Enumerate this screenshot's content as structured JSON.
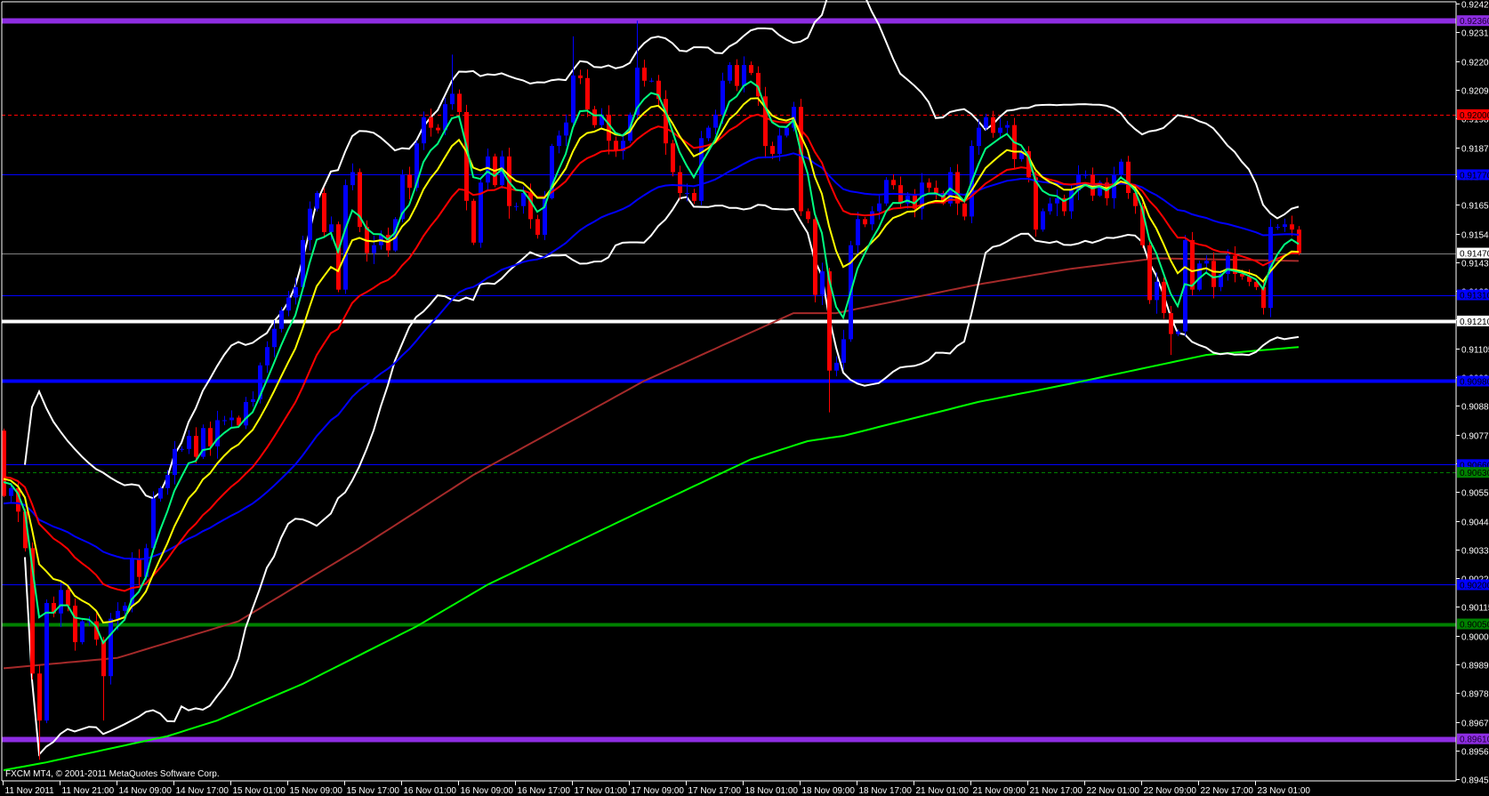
{
  "window": {
    "copyright": "FXCM MT4, © 2001-2011 MetaQuotes Software Corp."
  },
  "chart_data": {
    "type": "candlestick",
    "title": "",
    "ylim": [
      0.89449,
      0.92439
    ],
    "grid": false,
    "candle_colors": {
      "bull": "#0000ff",
      "bear": "#ff0000"
    },
    "y_ticks": [
      "0.92425",
      "0.92315",
      "0.92205",
      "0.92095",
      "0.91985",
      "0.91875",
      "0.91765",
      "0.91655",
      "0.91545",
      "0.91435",
      "0.91325",
      "0.91215",
      "0.91105",
      "0.90995",
      "0.90885",
      "0.90775",
      "0.90665",
      "0.90555",
      "0.90445",
      "0.90335",
      "0.90225",
      "0.90115",
      "0.90005",
      "0.89895",
      "0.89785",
      "0.89675",
      "0.89565",
      "0.89455"
    ],
    "x_tick_every_candles": 8,
    "x_tick_labels": [
      "11 Nov 2011",
      "11 Nov 21:00",
      "14 Nov 09:00",
      "14 Nov 17:00",
      "15 Nov 01:00",
      "15 Nov 09:00",
      "15 Nov 17:00",
      "16 Nov 01:00",
      "16 Nov 09:00",
      "16 Nov 17:00",
      "17 Nov 01:00",
      "17 Nov 09:00",
      "17 Nov 17:00",
      "18 Nov 01:00",
      "18 Nov 09:00",
      "18 Nov 17:00",
      "21 Nov 01:00",
      "21 Nov 09:00",
      "21 Nov 17:00",
      "22 Nov 01:00",
      "22 Nov 09:00",
      "22 Nov 17:00",
      "23 Nov 01:00"
    ],
    "first_open": 0.9079,
    "closes": [
      0.9054,
      0.9057,
      0.9048,
      0.9034,
      0.8986,
      0.8968,
      0.9013,
      0.9009,
      0.9018,
      0.9012,
      0.8998,
      0.9006,
      0.9006,
      0.8999,
      0.8985,
      0.9007,
      0.901,
      0.9012,
      0.903,
      0.9023,
      0.9034,
      0.9053,
      0.9057,
      0.9062,
      0.9072,
      0.9072,
      0.9077,
      0.9069,
      0.908,
      0.9073,
      0.9083,
      0.9083,
      0.9084,
      0.9081,
      0.909,
      0.9091,
      0.9104,
      0.9111,
      0.9118,
      0.9125,
      0.913,
      0.9134,
      0.9152,
      0.9164,
      0.917,
      0.9155,
      0.9158,
      0.9133,
      0.9173,
      0.9178,
      0.9157,
      0.9147,
      0.915,
      0.9154,
      0.9148,
      0.916,
      0.9177,
      0.9172,
      0.9189,
      0.9199,
      0.9195,
      0.9194,
      0.9204,
      0.9208,
      0.9201,
      0.9167,
      0.9151,
      0.9174,
      0.9184,
      0.9173,
      0.9184,
      0.9165,
      0.9165,
      0.917,
      0.916,
      0.9154,
      0.9168,
      0.9188,
      0.9192,
      0.9197,
      0.9215,
      0.9214,
      0.9202,
      0.9196,
      0.92,
      0.919,
      0.9186,
      0.919,
      0.92,
      0.9218,
      0.9213,
      0.9213,
      0.9206,
      0.9189,
      0.9178,
      0.917,
      0.917,
      0.9167,
      0.9191,
      0.9195,
      0.92,
      0.9213,
      0.9219,
      0.9211,
      0.9219,
      0.9216,
      0.9207,
      0.9188,
      0.9185,
      0.9192,
      0.9195,
      0.9203,
      0.9163,
      0.916,
      0.9131,
      0.914,
      0.9102,
      0.9105,
      0.9114,
      0.915,
      0.916,
      0.9158,
      0.9163,
      0.9166,
      0.9175,
      0.9173,
      0.9166,
      0.9169,
      0.9164,
      0.9174,
      0.9172,
      0.917,
      0.9166,
      0.9178,
      0.9166,
      0.9161,
      0.9188,
      0.9195,
      0.9199,
      0.9193,
      0.9195,
      0.9196,
      0.9183,
      0.9186,
      0.9176,
      0.9156,
      0.9163,
      0.9166,
      0.9168,
      0.9163,
      0.9171,
      0.9177,
      0.9177,
      0.9169,
      0.9174,
      0.9168,
      0.9177,
      0.9182,
      0.917,
      0.9165,
      0.915,
      0.9129,
      0.9136,
      0.9124,
      0.9116,
      0.9117,
      0.9152,
      0.9133,
      0.9143,
      0.9144,
      0.9134,
      0.9139,
      0.9146,
      0.9139,
      0.9138,
      0.9136,
      0.9134,
      0.9126,
      0.9157,
      0.9157,
      0.9158,
      0.9156,
      0.9147
    ],
    "extremes": [
      {
        "i": 5,
        "low": 0.8953
      },
      {
        "i": 14,
        "low": 0.8968
      },
      {
        "i": 63,
        "high": 0.9223
      },
      {
        "i": 80,
        "high": 0.923
      },
      {
        "i": 89,
        "high": 0.9236
      },
      {
        "i": 116,
        "low": 0.9086
      },
      {
        "i": 164,
        "low": 0.9108
      }
    ],
    "levels": [
      {
        "price": 0.9236,
        "label": "0.92360",
        "color": "#8e2de2",
        "label_text": "#1a0033",
        "style": "solid",
        "weight": "thick"
      },
      {
        "price": 0.92,
        "label": "0.92000",
        "color": "#ff0000",
        "label_text": "#000000",
        "style": "dashed",
        "weight": "thin"
      },
      {
        "price": 0.9177,
        "label": "0.91770",
        "color": "#0000ff",
        "label_text": "#000000",
        "style": "solid",
        "weight": "thin"
      },
      {
        "price": 0.9147,
        "label": "0.91470",
        "color": "#808080",
        "label_bg": "#ffffff",
        "label_text": "#000000",
        "style": "solid",
        "weight": "thin"
      },
      {
        "price": 0.9131,
        "label": "0.91310",
        "color": "#0000ff",
        "label_text": "#000000",
        "style": "solid",
        "weight": "thin"
      },
      {
        "price": 0.9121,
        "label": "0.91210",
        "color": "#ffffff",
        "label_text": "#000000",
        "style": "solid",
        "weight": "medium"
      },
      {
        "price": 0.9098,
        "label": "0.90980",
        "color": "#0000ff",
        "label_text": "#000000",
        "style": "solid",
        "weight": "medium"
      },
      {
        "price": 0.9066,
        "label": "0.90660",
        "color": "#0000ff",
        "label_text": "#000000",
        "style": "solid",
        "weight": "thin"
      },
      {
        "price": 0.9063,
        "label": "0.90630",
        "color": "#008000",
        "label_text": "#000000",
        "style": "dashed",
        "weight": "thin"
      },
      {
        "price": 0.902,
        "label": "0.90200",
        "color": "#0000ff",
        "label_text": "#000000",
        "style": "solid",
        "weight": "thin"
      },
      {
        "price": 0.9005,
        "label": "0.90050",
        "color": "#008000",
        "label_text": "#000000",
        "style": "solid",
        "weight": "medium"
      },
      {
        "price": 0.8961,
        "label": "0.89610",
        "color": "#8e2de2",
        "label_text": "#1a0033",
        "style": "solid",
        "weight": "thick"
      }
    ],
    "indicators": {
      "ema": [
        {
          "name": "ema-blue",
          "period": 50,
          "color": "#0000ff",
          "seed": 0.9051
        },
        {
          "name": "ema-red",
          "period": 21,
          "color": "#ff0000",
          "seed": 0.9062
        },
        {
          "name": "ema-yellow",
          "period": 10,
          "color": "#ffff00",
          "seed": 0.9062
        },
        {
          "name": "ema-green",
          "period": 5,
          "color": "#00ff80",
          "seed": 0.9062
        }
      ],
      "bollinger": {
        "period": 20,
        "deviations": 2,
        "color": "#ffffff"
      },
      "long_ma": [
        {
          "name": "brown-ma",
          "color": "#a52a2a",
          "points": [
            [
              0,
              0.8988
            ],
            [
              16,
              0.8992
            ],
            [
              33,
              0.9006
            ],
            [
              50,
              0.9034
            ],
            [
              66,
              0.9062
            ],
            [
              90,
              0.9098
            ],
            [
              111,
              0.9124
            ],
            [
              117,
              0.9124
            ],
            [
              137,
              0.9135
            ],
            [
              150,
              0.9141
            ],
            [
              162,
              0.9145
            ],
            [
              182,
              0.9144
            ]
          ]
        },
        {
          "name": "lime-ma",
          "color": "#00ff00",
          "points": [
            [
              0,
              0.8949
            ],
            [
              6,
              0.8952
            ],
            [
              23,
              0.8962
            ],
            [
              30,
              0.8968
            ],
            [
              42,
              0.8982
            ],
            [
              50,
              0.8993
            ],
            [
              58,
              0.9004
            ],
            [
              68,
              0.902
            ],
            [
              91,
              0.905
            ],
            [
              105,
              0.9068
            ],
            [
              113,
              0.9075
            ],
            [
              118,
              0.9077
            ],
            [
              137,
              0.909
            ],
            [
              150,
              0.9097
            ],
            [
              169,
              0.9108
            ],
            [
              182,
              0.9111
            ]
          ]
        }
      ]
    }
  }
}
